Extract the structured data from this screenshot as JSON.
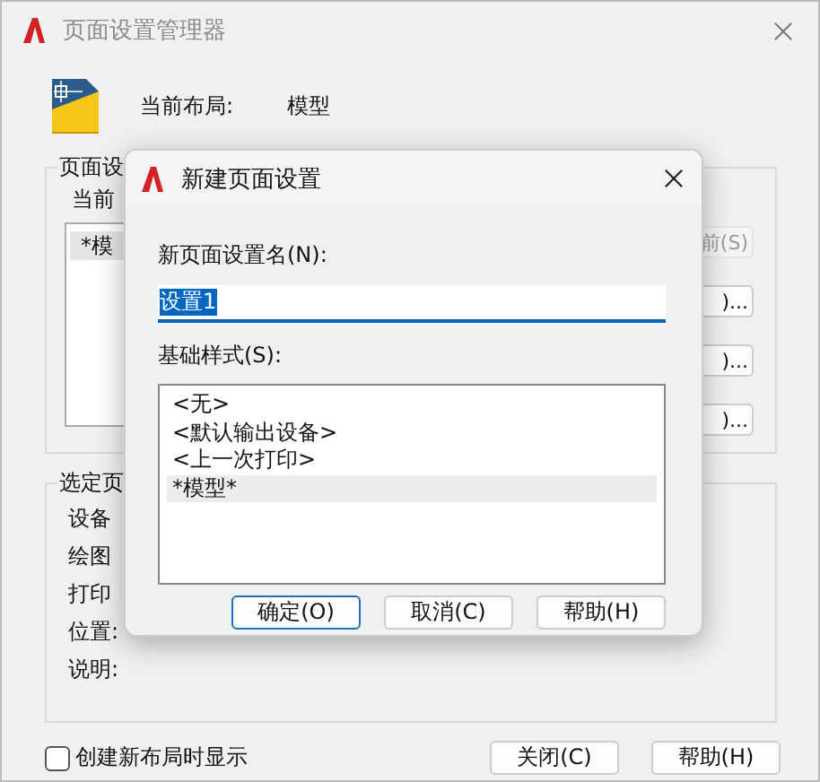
{
  "window": {
    "title": "页面设置管理器"
  },
  "current_layout": {
    "label": "当前布局:",
    "value": "模型"
  },
  "page_setups": {
    "label": "页面设",
    "current_label": "当前",
    "list": [
      {
        "text": "*模",
        "selected": true
      }
    ],
    "buttons": [
      {
        "label": "前(S)",
        "disabled": true
      },
      {
        "label": ")...",
        "disabled": false
      },
      {
        "label": ")...",
        "disabled": false
      },
      {
        "label": ")...",
        "disabled": false
      }
    ]
  },
  "selected_setup": {
    "label": "选定页",
    "rows": [
      "设备",
      "绘图",
      "打印",
      "位置:",
      "说明:"
    ]
  },
  "show_on_create": {
    "label": "创建新布局时显示",
    "checked": false
  },
  "buttons": [
    "关闭(C)",
    "帮助(H)"
  ],
  "dialog": {
    "title": "新建页面设置",
    "name_label": "新页面设置名(N):",
    "name_value": "设置1",
    "base_label": "基础样式(S):",
    "styles": [
      {
        "text": "<无>",
        "selected": false
      },
      {
        "text": "<默认输出设备>",
        "selected": false
      },
      {
        "text": "<上一次打印>",
        "selected": false
      },
      {
        "text": "*模型*",
        "selected": true
      }
    ],
    "buttons": [
      {
        "label": "确定(O)",
        "default": true
      },
      {
        "label": "取消(C)",
        "default": false
      },
      {
        "label": "帮助(H)",
        "default": false
      }
    ]
  }
}
